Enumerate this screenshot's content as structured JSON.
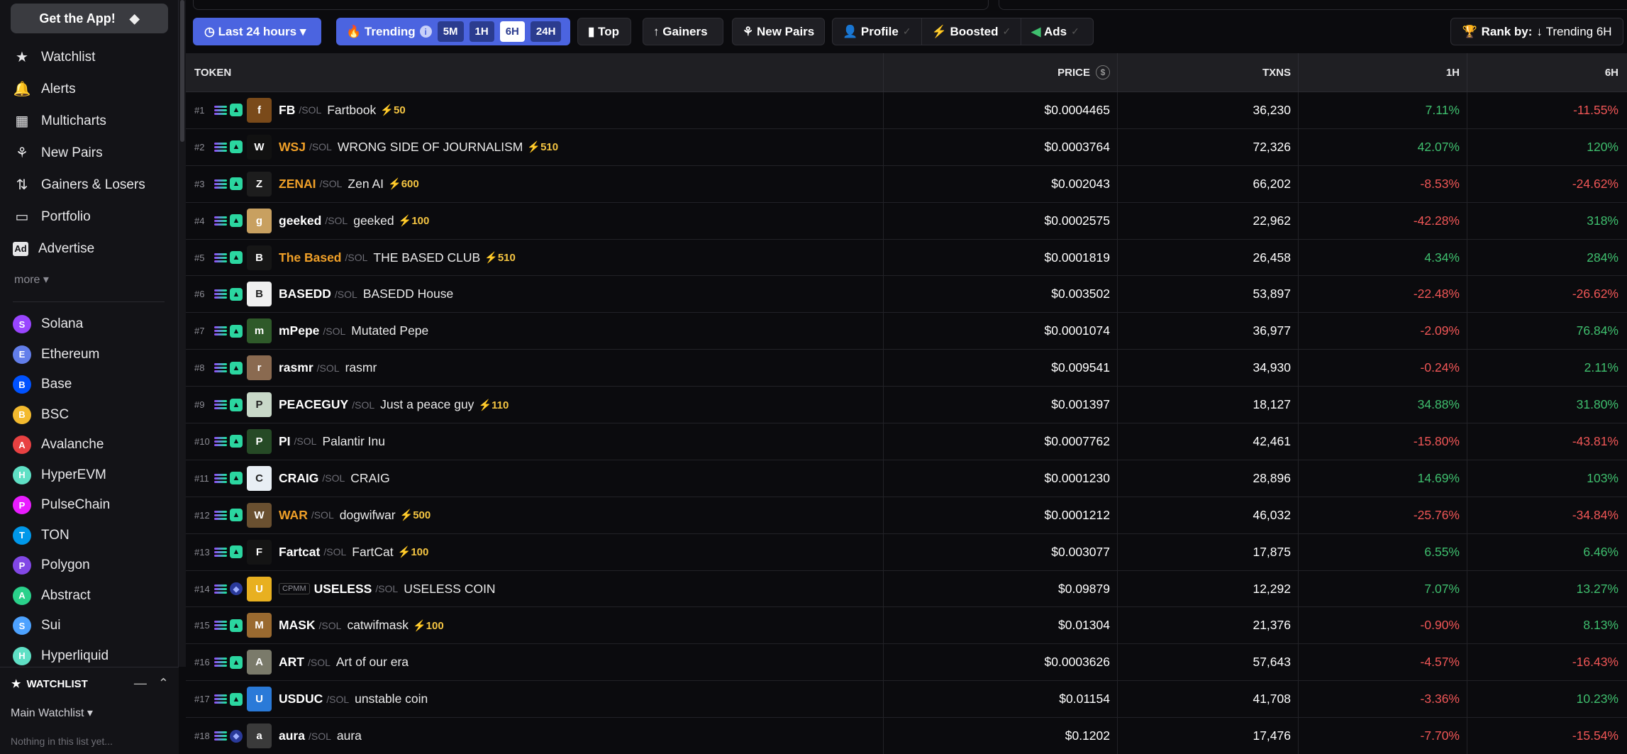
{
  "sidebar": {
    "get_app": "Get the App!",
    "nav": [
      {
        "label": "Watchlist",
        "icon": "star-icon"
      },
      {
        "label": "Alerts",
        "icon": "bell-icon"
      },
      {
        "label": "Multicharts",
        "icon": "grid-icon"
      },
      {
        "label": "New Pairs",
        "icon": "sprout-icon"
      },
      {
        "label": "Gainers & Losers",
        "icon": "arrows-updown-icon"
      },
      {
        "label": "Portfolio",
        "icon": "wallet-icon"
      },
      {
        "label": "Advertise",
        "icon": "ad-icon"
      }
    ],
    "more": "more",
    "chains": [
      {
        "label": "Solana",
        "color": "#9945ff"
      },
      {
        "label": "Ethereum",
        "color": "#627eea"
      },
      {
        "label": "Base",
        "color": "#0052ff"
      },
      {
        "label": "BSC",
        "color": "#f3ba2f"
      },
      {
        "label": "Avalanche",
        "color": "#e84142"
      },
      {
        "label": "HyperEVM",
        "color": "#5fe0c5"
      },
      {
        "label": "PulseChain",
        "color": "#e81cff"
      },
      {
        "label": "TON",
        "color": "#0098ea"
      },
      {
        "label": "Polygon",
        "color": "#8247e5"
      },
      {
        "label": "Abstract",
        "color": "#2ad18b"
      },
      {
        "label": "Sui",
        "color": "#4da2ff"
      },
      {
        "label": "Hyperliquid",
        "color": "#5fe0c5"
      }
    ],
    "watchlist": {
      "title": "WATCHLIST",
      "main": "Main Watchlist",
      "empty": "Nothing in this list yet..."
    }
  },
  "toolbar": {
    "time_range": "Last 24 hours",
    "trending": "Trending",
    "segments": [
      "5M",
      "1H",
      "6H",
      "24H"
    ],
    "top": "Top",
    "gainers": "Gainers",
    "new_pairs": "New Pairs",
    "profile": "Profile",
    "boosted": "Boosted",
    "ads": "Ads",
    "rank_by_label": "Rank by:",
    "rank_by_value": "Trending 6H"
  },
  "table": {
    "headers": {
      "token": "TOKEN",
      "price": "PRICE",
      "txns": "TXNS",
      "h1": "1H",
      "h6": "6H"
    },
    "rows": [
      {
        "rank": "#1",
        "sym": "FB",
        "name": "Fartbook",
        "boost": "50",
        "price": "$0.0004465",
        "txns": "36,230",
        "h1": "7.11%",
        "h6": "-11.55%",
        "orange": false,
        "av": "#7a4a1a",
        "avt": "f"
      },
      {
        "rank": "#2",
        "sym": "WSJ",
        "name": "WRONG SIDE OF JOURNALISM",
        "boost": "510",
        "price": "$0.0003764",
        "txns": "72,326",
        "h1": "42.07%",
        "h6": "120%",
        "orange": true,
        "av": "#111111",
        "avt": "W"
      },
      {
        "rank": "#3",
        "sym": "ZENAI",
        "name": "Zen AI",
        "boost": "600",
        "price": "$0.002043",
        "txns": "66,202",
        "h1": "-8.53%",
        "h6": "-24.62%",
        "orange": true,
        "av": "#1d1d1d",
        "avt": "Z"
      },
      {
        "rank": "#4",
        "sym": "geeked",
        "name": "geeked",
        "boost": "100",
        "price": "$0.0002575",
        "txns": "22,962",
        "h1": "-42.28%",
        "h6": "318%",
        "orange": false,
        "av": "#c8a060",
        "avt": "g"
      },
      {
        "rank": "#5",
        "sym": "The Based",
        "name": "THE BASED CLUB",
        "boost": "510",
        "price": "$0.0001819",
        "txns": "26,458",
        "h1": "4.34%",
        "h6": "284%",
        "orange": true,
        "av": "#161616",
        "avt": "B"
      },
      {
        "rank": "#6",
        "sym": "BASEDD",
        "name": "BASEDD House",
        "boost": "",
        "price": "$0.003502",
        "txns": "53,897",
        "h1": "-22.48%",
        "h6": "-26.62%",
        "orange": false,
        "av": "#f0f0f0",
        "avt": "B"
      },
      {
        "rank": "#7",
        "sym": "mPepe",
        "name": "Mutated Pepe",
        "boost": "",
        "price": "$0.0001074",
        "txns": "36,977",
        "h1": "-2.09%",
        "h6": "76.84%",
        "orange": false,
        "av": "#2f5a2a",
        "avt": "m"
      },
      {
        "rank": "#8",
        "sym": "rasmr",
        "name": "rasmr",
        "boost": "",
        "price": "$0.009541",
        "txns": "34,930",
        "h1": "-0.24%",
        "h6": "2.11%",
        "orange": false,
        "av": "#8a6a50",
        "avt": "r"
      },
      {
        "rank": "#9",
        "sym": "PEACEGUY",
        "name": "Just a peace guy",
        "boost": "110",
        "price": "$0.001397",
        "txns": "18,127",
        "h1": "34.88%",
        "h6": "31.80%",
        "orange": false,
        "av": "#c8d8c8",
        "avt": "P"
      },
      {
        "rank": "#10",
        "sym": "PI",
        "name": "Palantir Inu",
        "boost": "",
        "price": "$0.0007762",
        "txns": "42,461",
        "h1": "-15.80%",
        "h6": "-43.81%",
        "orange": false,
        "av": "#264a26",
        "avt": "P"
      },
      {
        "rank": "#11",
        "sym": "CRAIG",
        "name": "CRAIG",
        "boost": "",
        "price": "$0.0001230",
        "txns": "28,896",
        "h1": "14.69%",
        "h6": "103%",
        "orange": false,
        "av": "#e8eef4",
        "avt": "C"
      },
      {
        "rank": "#12",
        "sym": "WAR",
        "name": "dogwifwar",
        "boost": "500",
        "price": "$0.0001212",
        "txns": "46,032",
        "h1": "-25.76%",
        "h6": "-34.84%",
        "orange": true,
        "av": "#6a5030",
        "avt": "W"
      },
      {
        "rank": "#13",
        "sym": "Fartcat",
        "name": "FartCat",
        "boost": "100",
        "price": "$0.003077",
        "txns": "17,875",
        "h1": "6.55%",
        "h6": "6.46%",
        "orange": false,
        "av": "#141414",
        "avt": "F"
      },
      {
        "rank": "#14",
        "sym": "USELESS",
        "name": "USELESS COIN",
        "boost": "",
        "price": "$0.09879",
        "txns": "12,292",
        "h1": "7.07%",
        "h6": "13.27%",
        "orange": false,
        "av": "#e8b020",
        "avt": "U",
        "cpmm": "CPMM",
        "alt": true
      },
      {
        "rank": "#15",
        "sym": "MASK",
        "name": "catwifmask",
        "boost": "100",
        "price": "$0.01304",
        "txns": "21,376",
        "h1": "-0.90%",
        "h6": "8.13%",
        "orange": false,
        "av": "#9a6a30",
        "avt": "M"
      },
      {
        "rank": "#16",
        "sym": "ART",
        "name": "Art of our era",
        "boost": "",
        "price": "$0.0003626",
        "txns": "57,643",
        "h1": "-4.57%",
        "h6": "-16.43%",
        "orange": false,
        "av": "#7a7a6a",
        "avt": "A"
      },
      {
        "rank": "#17",
        "sym": "USDUC",
        "name": "unstable coin",
        "boost": "",
        "price": "$0.01154",
        "txns": "41,708",
        "h1": "-3.36%",
        "h6": "10.23%",
        "orange": false,
        "av": "#2a7ad8",
        "avt": "U"
      },
      {
        "rank": "#18",
        "sym": "aura",
        "name": "aura",
        "boost": "",
        "price": "$0.1202",
        "txns": "17,476",
        "h1": "-7.70%",
        "h6": "-15.54%",
        "orange": false,
        "av": "#3a3a3a",
        "avt": "a",
        "alt": true
      }
    ]
  }
}
